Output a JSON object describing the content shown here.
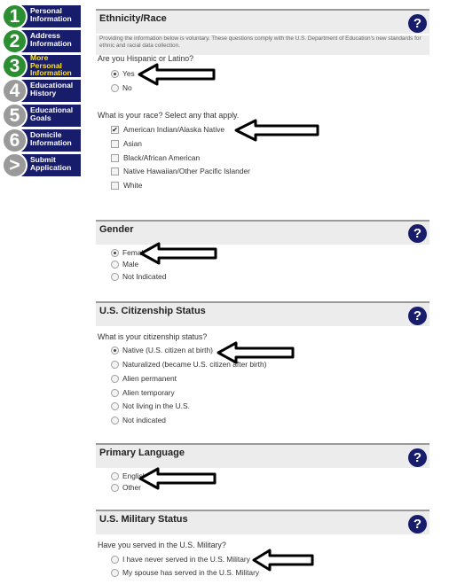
{
  "steps": [
    {
      "number": "1",
      "label": "Personal Information",
      "state": "done"
    },
    {
      "number": "2",
      "label": "Address Information",
      "state": "done"
    },
    {
      "number": "3",
      "label": "More Personal Information",
      "state": "current"
    },
    {
      "number": "4",
      "label": "Educational History",
      "state": "todo"
    },
    {
      "number": "5",
      "label": "Educational Goals",
      "state": "todo"
    },
    {
      "number": "6",
      "label": "Domicile Information",
      "state": "todo"
    },
    {
      "number": ">",
      "label": "Submit Application",
      "state": "todo"
    }
  ],
  "help_symbol": "?",
  "ethnicity": {
    "title": "Ethnicity/Race",
    "intro": "Providing the information below is voluntary. These questions comply with the U.S. Department of Education's new standards for ethnic and racial data collection.",
    "hispanic_question": "Are you Hispanic or Latino?",
    "hispanic_options": [
      "Yes",
      "No"
    ],
    "hispanic_selected": "Yes",
    "race_question": "What is your race? Select any that apply.",
    "race_options": [
      "American Indian/Alaska Native",
      "Asian",
      "Black/African American",
      "Native Hawaiian/Other Pacific Islander",
      "White"
    ],
    "race_checked": [
      "American Indian/Alaska Native"
    ]
  },
  "gender": {
    "title": "Gender",
    "options": [
      "Female",
      "Male",
      "Not Indicated"
    ],
    "selected": "Female"
  },
  "citizenship": {
    "title": "U.S. Citizenship Status",
    "question": "What is your citizenship status?",
    "options": [
      "Native (U.S. citizen at birth)",
      "Naturalized (became U.S. citizen after birth)",
      "Alien permanent",
      "Alien temporary",
      "Not living in the U.S.",
      "Not indicated"
    ],
    "selected": "Native (U.S. citizen at birth)"
  },
  "language": {
    "title": "Primary Language",
    "options": [
      "English",
      "Other"
    ],
    "selected": ""
  },
  "military": {
    "title": "U.S. Military Status",
    "question": "Have you served in the U.S. Military?",
    "options": [
      "I have never served in the U.S. Military",
      "My spouse has served in the U.S. Military"
    ],
    "selected": ""
  },
  "checkmark_glyph": "✔"
}
